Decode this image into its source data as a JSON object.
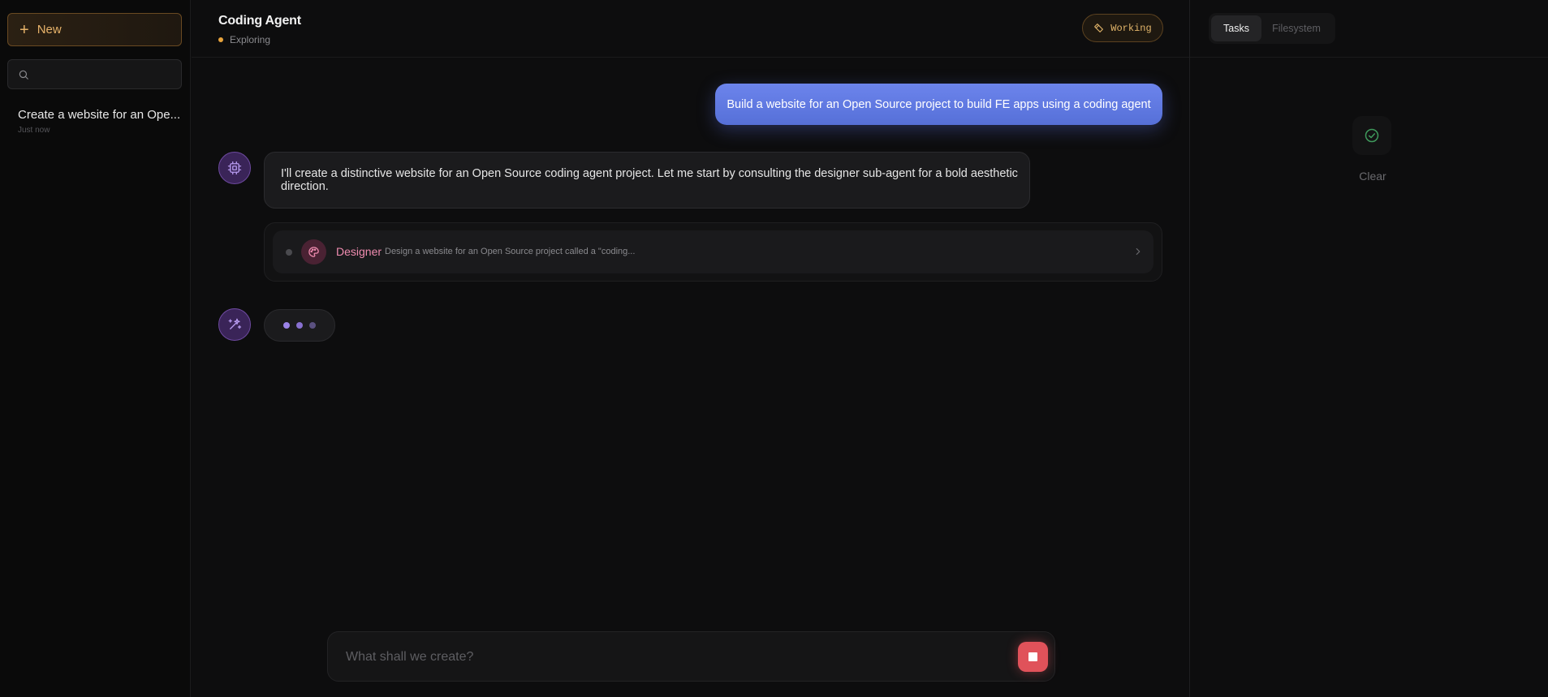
{
  "sidebar": {
    "new_label": "New",
    "search_placeholder": "",
    "conversations": [
      {
        "title": "Create a website for an Ope...",
        "time": "Just now"
      }
    ]
  },
  "header": {
    "title": "Coding Agent",
    "status": "Exploring",
    "badge": "Working"
  },
  "chat": {
    "user_message": "Build a website for an Open Source project to build FE apps using a coding agent",
    "agent_message": "I'll create a distinctive website for an Open Source coding agent project. Let me start by consulting the designer sub-agent for a bold aesthetic direction.",
    "subagent": {
      "name": "Designer",
      "description": "Design a website for an Open Source project called a \"coding..."
    },
    "composer_placeholder": "What shall we create?"
  },
  "right_panel": {
    "tabs": [
      "Tasks",
      "Filesystem"
    ],
    "active_tab": "Tasks",
    "empty_label": "Clear"
  },
  "colors": {
    "accent": "#e7b36a",
    "user_bubble": "#6378e0",
    "stop": "#e0525a",
    "designer": "#f08cb0",
    "avatar": "#3a2458"
  }
}
